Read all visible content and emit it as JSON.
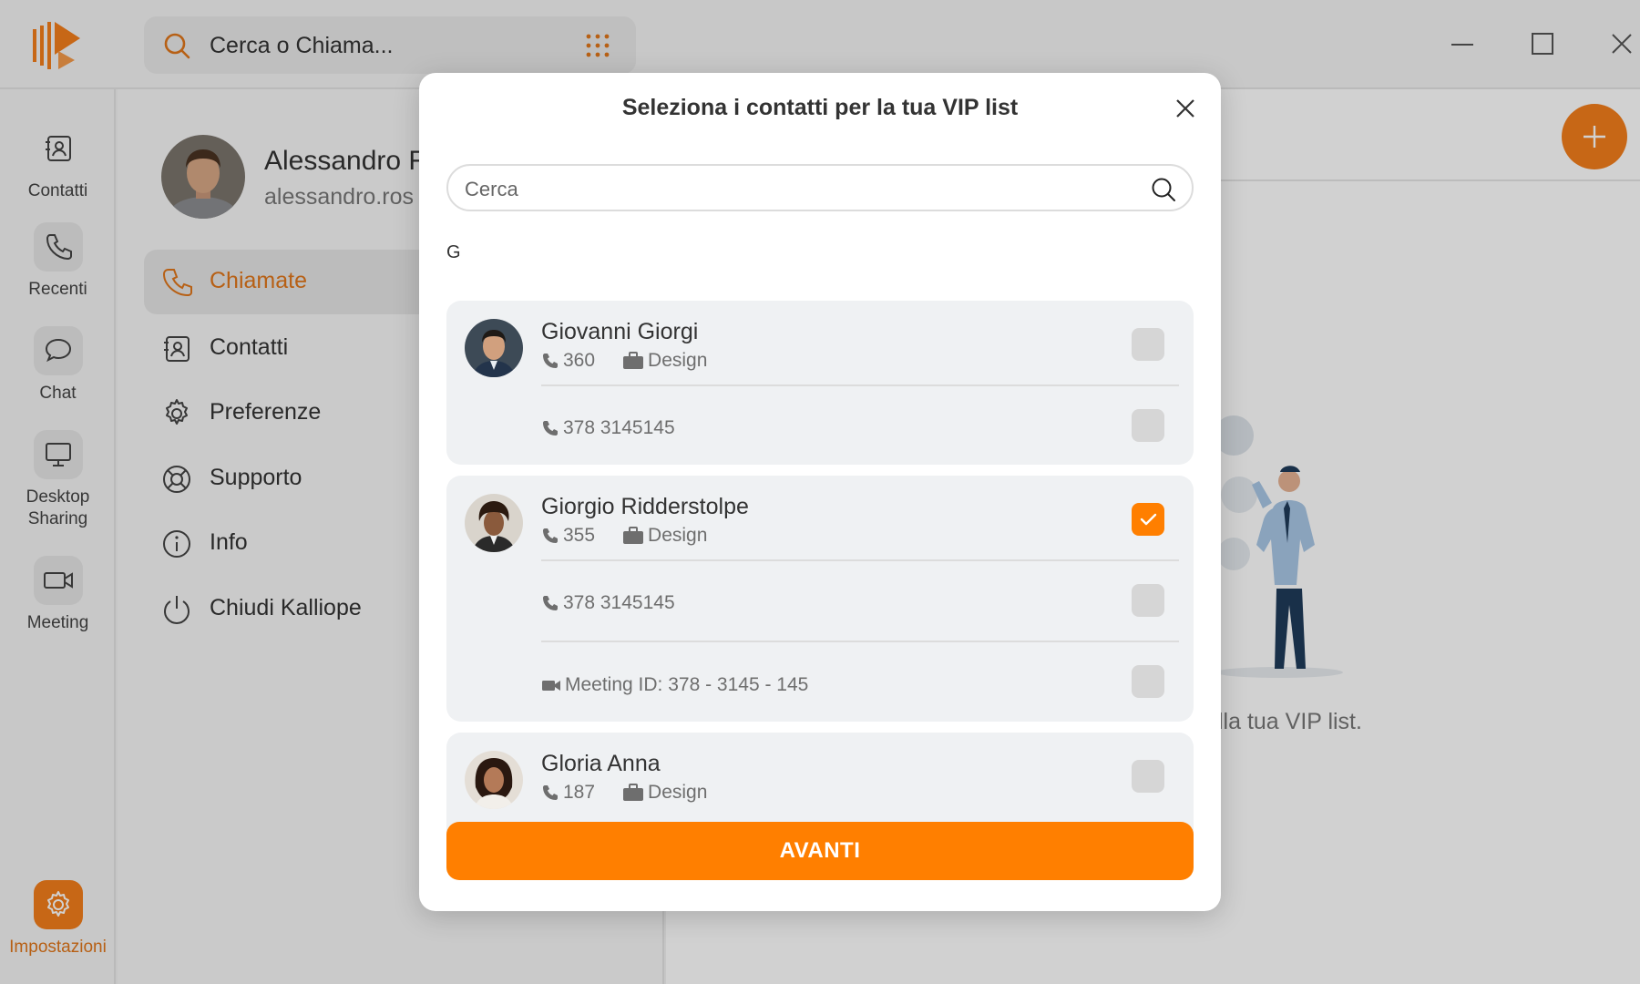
{
  "app": {
    "search_placeholder": "Cerca o Chiama...",
    "accent_color": "#ff7f00"
  },
  "rail": {
    "items": [
      {
        "label": "Contatti",
        "icon": "address-book-icon"
      },
      {
        "label": "Recenti",
        "icon": "phone-icon"
      },
      {
        "label": "Chat",
        "icon": "chat-bubble-icon"
      },
      {
        "label": "Desktop Sharing",
        "icon": "monitor-icon"
      },
      {
        "label": "Meeting",
        "icon": "video-camera-icon"
      }
    ],
    "settings_label": "Impostazioni"
  },
  "profile": {
    "name": "Alessandro R",
    "email": "alessandro.ros"
  },
  "settings_menu": [
    {
      "label": "Chiamate",
      "icon": "phone-icon",
      "active": true
    },
    {
      "label": "Contatti",
      "icon": "address-book-icon"
    },
    {
      "label": "Preferenze",
      "icon": "gear-icon"
    },
    {
      "label": "Supporto",
      "icon": "lifebuoy-icon"
    },
    {
      "label": "Info",
      "icon": "info-icon"
    },
    {
      "label": "Chiudi Kalliope",
      "icon": "power-icon"
    }
  ],
  "content": {
    "empty_text": "lla tua VIP list."
  },
  "modal": {
    "title": "Seleziona i contatti per la tua VIP list",
    "search_placeholder": "Cerca",
    "section_letter": "G",
    "contacts": [
      {
        "name": "Giovanni Giorgi",
        "extension": "360",
        "department": "Design",
        "checked": false,
        "numbers": [
          {
            "type": "phone",
            "value": "378 3145145",
            "checked": false
          }
        ]
      },
      {
        "name": "Giorgio Ridderstolpe",
        "extension": "355",
        "department": "Design",
        "checked": true,
        "numbers": [
          {
            "type": "phone",
            "value": "378 3145145",
            "checked": false
          },
          {
            "type": "meeting",
            "value": "Meeting ID: 378 - 3145 - 145",
            "checked": false
          }
        ]
      },
      {
        "name": "Gloria Anna",
        "extension": "187",
        "department": "Design",
        "checked": false
      }
    ],
    "next_button": "AVANTI"
  }
}
